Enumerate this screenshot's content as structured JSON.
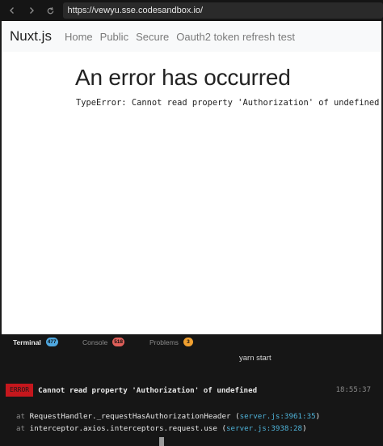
{
  "browser": {
    "url": "https://vewyu.sse.codesandbox.io/",
    "icons": [
      "back-icon",
      "forward-icon",
      "reload-icon"
    ]
  },
  "nav": {
    "brand": "Nuxt.js",
    "links": [
      "Home",
      "Public",
      "Secure",
      "Oauth2 token refresh test"
    ]
  },
  "error": {
    "title": "An error has occurred",
    "message": "TypeError: Cannot read property 'Authorization' of undefined"
  },
  "panel": {
    "tabs": [
      {
        "label": "Terminal",
        "badge": "477",
        "badge_color": "#4fa8e0",
        "active": true
      },
      {
        "label": "Console",
        "badge": "518",
        "badge_color": "#e0605a",
        "active": false
      },
      {
        "label": "Problems",
        "badge": "3",
        "badge_color": "#f0a030",
        "active": false
      }
    ],
    "command": "yarn start",
    "error_tag": "ERROR",
    "error_text": "Cannot read property 'Authorization' of undefined",
    "error_time": "18:55:37",
    "stack": [
      {
        "at": "at",
        "fn": "RequestHandler._requestHasAuthorizationHeader",
        "loc": "server.js:3961:35"
      },
      {
        "at": "at",
        "fn": "interceptor.axios.interceptors.request.use",
        "loc": "server.js:3938:28"
      }
    ]
  }
}
